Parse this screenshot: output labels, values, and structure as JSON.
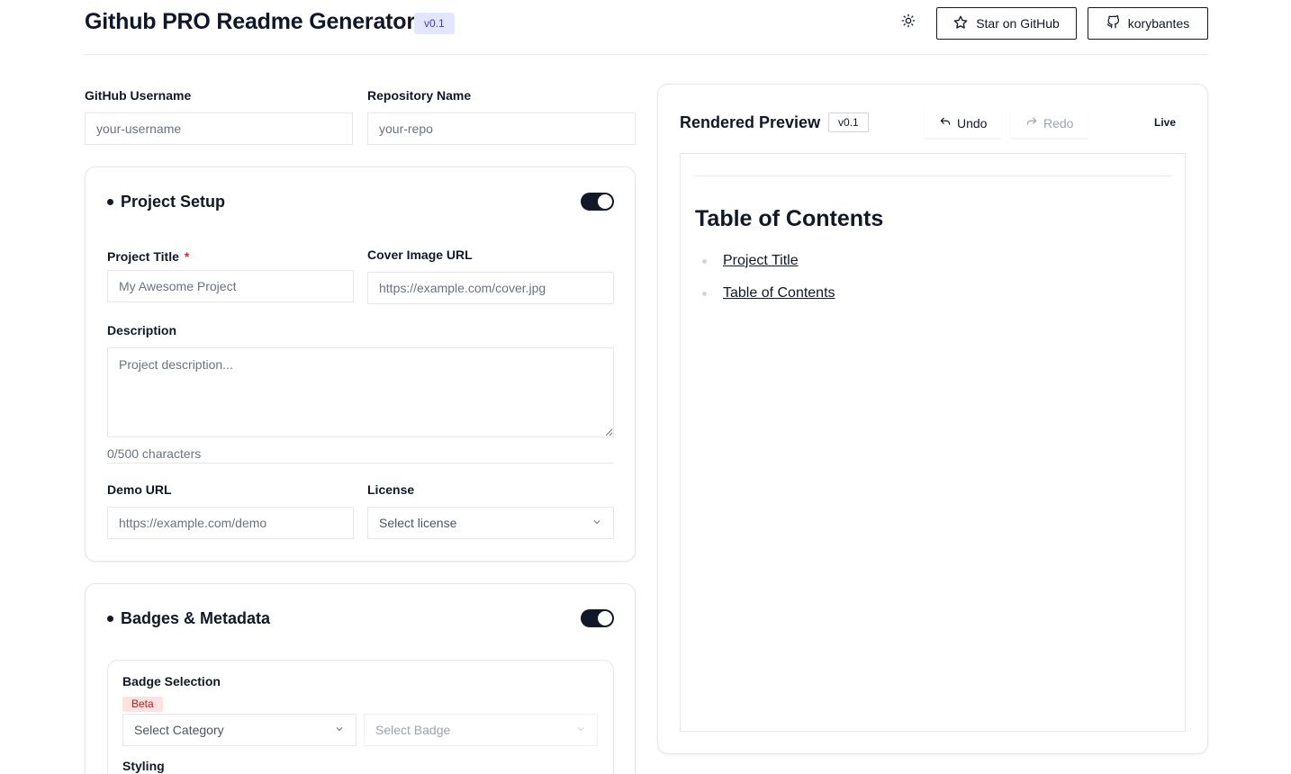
{
  "header": {
    "title": "Github PRO Readme Generator",
    "version": "v0.1",
    "theme_toggle_icon": "sun-icon",
    "star_label": "Star on GitHub",
    "user_label": "korybantes"
  },
  "top_fields": {
    "username_label": "GitHub Username",
    "username_placeholder": "your-username",
    "repo_label": "Repository Name",
    "repo_placeholder": "your-repo"
  },
  "project_setup": {
    "title": "Project Setup",
    "enabled": true,
    "title_label": "Project Title",
    "required_mark": "*",
    "title_placeholder": "My Awesome Project",
    "cover_label": "Cover Image URL",
    "cover_placeholder": "https://example.com/cover.jpg",
    "description_label": "Description",
    "description_placeholder": "Project description...",
    "char_count": "0/500 characters",
    "demo_label": "Demo URL",
    "demo_placeholder": "https://example.com/demo",
    "license_label": "License",
    "license_value": "Select license"
  },
  "badges": {
    "title": "Badges & Metadata",
    "enabled": true,
    "selection_label": "Badge Selection",
    "beta_label": "Beta",
    "category_value": "Select Category",
    "badge_value": "Select Badge",
    "styling_label": "Styling"
  },
  "preview": {
    "title": "Rendered Preview",
    "version": "v0.1",
    "undo_label": "Undo",
    "redo_label": "Redo",
    "live_label": "Live",
    "toc_heading": "Table of Contents",
    "toc_items": [
      "Project Title",
      "Table of Contents"
    ]
  },
  "colors": {
    "primary": "#111827",
    "badge_bg": "#e0e7ff",
    "badge_text": "#4338ca",
    "required": "#dc2626",
    "beta_bg": "#fee2e2",
    "beta_text": "#b91c1c",
    "border": "#e5e7eb"
  }
}
